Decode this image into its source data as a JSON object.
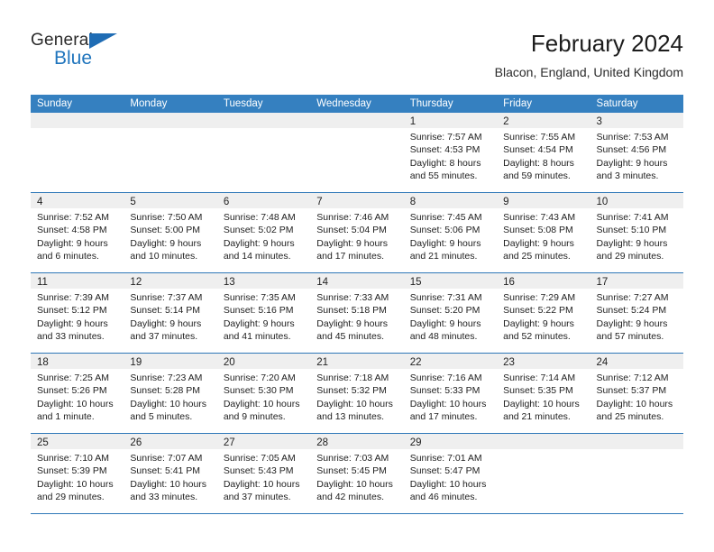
{
  "brand": {
    "name_top": "General",
    "name_bottom": "Blue",
    "accent_color": "#2075bd",
    "triangle_color": "#1f6cb4"
  },
  "header": {
    "title": "February 2024",
    "location": "Blacon, England, United Kingdom"
  },
  "theme": {
    "header_bar": "#3580c0",
    "row_divider": "#2e78b8",
    "datebar_bg": "#efefef",
    "text": "#1e1e1e"
  },
  "weekdays": [
    "Sunday",
    "Monday",
    "Tuesday",
    "Wednesday",
    "Thursday",
    "Friday",
    "Saturday"
  ],
  "weeks": [
    [
      {
        "day": "",
        "lines": []
      },
      {
        "day": "",
        "lines": []
      },
      {
        "day": "",
        "lines": []
      },
      {
        "day": "",
        "lines": []
      },
      {
        "day": "1",
        "lines": [
          "Sunrise: 7:57 AM",
          "Sunset: 4:53 PM",
          "Daylight: 8 hours",
          "and 55 minutes."
        ]
      },
      {
        "day": "2",
        "lines": [
          "Sunrise: 7:55 AM",
          "Sunset: 4:54 PM",
          "Daylight: 8 hours",
          "and 59 minutes."
        ]
      },
      {
        "day": "3",
        "lines": [
          "Sunrise: 7:53 AM",
          "Sunset: 4:56 PM",
          "Daylight: 9 hours",
          "and 3 minutes."
        ]
      }
    ],
    [
      {
        "day": "4",
        "lines": [
          "Sunrise: 7:52 AM",
          "Sunset: 4:58 PM",
          "Daylight: 9 hours",
          "and 6 minutes."
        ]
      },
      {
        "day": "5",
        "lines": [
          "Sunrise: 7:50 AM",
          "Sunset: 5:00 PM",
          "Daylight: 9 hours",
          "and 10 minutes."
        ]
      },
      {
        "day": "6",
        "lines": [
          "Sunrise: 7:48 AM",
          "Sunset: 5:02 PM",
          "Daylight: 9 hours",
          "and 14 minutes."
        ]
      },
      {
        "day": "7",
        "lines": [
          "Sunrise: 7:46 AM",
          "Sunset: 5:04 PM",
          "Daylight: 9 hours",
          "and 17 minutes."
        ]
      },
      {
        "day": "8",
        "lines": [
          "Sunrise: 7:45 AM",
          "Sunset: 5:06 PM",
          "Daylight: 9 hours",
          "and 21 minutes."
        ]
      },
      {
        "day": "9",
        "lines": [
          "Sunrise: 7:43 AM",
          "Sunset: 5:08 PM",
          "Daylight: 9 hours",
          "and 25 minutes."
        ]
      },
      {
        "day": "10",
        "lines": [
          "Sunrise: 7:41 AM",
          "Sunset: 5:10 PM",
          "Daylight: 9 hours",
          "and 29 minutes."
        ]
      }
    ],
    [
      {
        "day": "11",
        "lines": [
          "Sunrise: 7:39 AM",
          "Sunset: 5:12 PM",
          "Daylight: 9 hours",
          "and 33 minutes."
        ]
      },
      {
        "day": "12",
        "lines": [
          "Sunrise: 7:37 AM",
          "Sunset: 5:14 PM",
          "Daylight: 9 hours",
          "and 37 minutes."
        ]
      },
      {
        "day": "13",
        "lines": [
          "Sunrise: 7:35 AM",
          "Sunset: 5:16 PM",
          "Daylight: 9 hours",
          "and 41 minutes."
        ]
      },
      {
        "day": "14",
        "lines": [
          "Sunrise: 7:33 AM",
          "Sunset: 5:18 PM",
          "Daylight: 9 hours",
          "and 45 minutes."
        ]
      },
      {
        "day": "15",
        "lines": [
          "Sunrise: 7:31 AM",
          "Sunset: 5:20 PM",
          "Daylight: 9 hours",
          "and 48 minutes."
        ]
      },
      {
        "day": "16",
        "lines": [
          "Sunrise: 7:29 AM",
          "Sunset: 5:22 PM",
          "Daylight: 9 hours",
          "and 52 minutes."
        ]
      },
      {
        "day": "17",
        "lines": [
          "Sunrise: 7:27 AM",
          "Sunset: 5:24 PM",
          "Daylight: 9 hours",
          "and 57 minutes."
        ]
      }
    ],
    [
      {
        "day": "18",
        "lines": [
          "Sunrise: 7:25 AM",
          "Sunset: 5:26 PM",
          "Daylight: 10 hours",
          "and 1 minute."
        ]
      },
      {
        "day": "19",
        "lines": [
          "Sunrise: 7:23 AM",
          "Sunset: 5:28 PM",
          "Daylight: 10 hours",
          "and 5 minutes."
        ]
      },
      {
        "day": "20",
        "lines": [
          "Sunrise: 7:20 AM",
          "Sunset: 5:30 PM",
          "Daylight: 10 hours",
          "and 9 minutes."
        ]
      },
      {
        "day": "21",
        "lines": [
          "Sunrise: 7:18 AM",
          "Sunset: 5:32 PM",
          "Daylight: 10 hours",
          "and 13 minutes."
        ]
      },
      {
        "day": "22",
        "lines": [
          "Sunrise: 7:16 AM",
          "Sunset: 5:33 PM",
          "Daylight: 10 hours",
          "and 17 minutes."
        ]
      },
      {
        "day": "23",
        "lines": [
          "Sunrise: 7:14 AM",
          "Sunset: 5:35 PM",
          "Daylight: 10 hours",
          "and 21 minutes."
        ]
      },
      {
        "day": "24",
        "lines": [
          "Sunrise: 7:12 AM",
          "Sunset: 5:37 PM",
          "Daylight: 10 hours",
          "and 25 minutes."
        ]
      }
    ],
    [
      {
        "day": "25",
        "lines": [
          "Sunrise: 7:10 AM",
          "Sunset: 5:39 PM",
          "Daylight: 10 hours",
          "and 29 minutes."
        ]
      },
      {
        "day": "26",
        "lines": [
          "Sunrise: 7:07 AM",
          "Sunset: 5:41 PM",
          "Daylight: 10 hours",
          "and 33 minutes."
        ]
      },
      {
        "day": "27",
        "lines": [
          "Sunrise: 7:05 AM",
          "Sunset: 5:43 PM",
          "Daylight: 10 hours",
          "and 37 minutes."
        ]
      },
      {
        "day": "28",
        "lines": [
          "Sunrise: 7:03 AM",
          "Sunset: 5:45 PM",
          "Daylight: 10 hours",
          "and 42 minutes."
        ]
      },
      {
        "day": "29",
        "lines": [
          "Sunrise: 7:01 AM",
          "Sunset: 5:47 PM",
          "Daylight: 10 hours",
          "and 46 minutes."
        ]
      },
      {
        "day": "",
        "lines": []
      },
      {
        "day": "",
        "lines": []
      }
    ]
  ]
}
